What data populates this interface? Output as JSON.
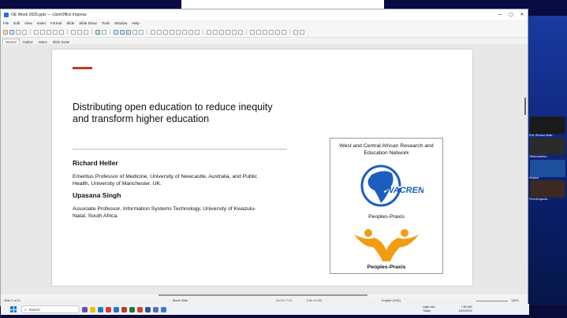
{
  "window": {
    "title": "OE Week 2025.pptx — LibreOffice Impress",
    "min": "—",
    "max": "▢",
    "close": "✕"
  },
  "menu": [
    "File",
    "Edit",
    "View",
    "Insert",
    "Format",
    "Slide",
    "Slide Show",
    "Tools",
    "Window",
    "Help"
  ],
  "tabs": [
    "Normal",
    "Outline",
    "Notes",
    "Slide Sorter"
  ],
  "slide": {
    "title": "Distributing open education to reduce inequity and transform higher education",
    "presenter1": {
      "name": "Richard Heller",
      "affiliation": "Emeritus Professor of Medicine, University of Newcastle, Australia, and Public Health, University of Manchester, UK."
    },
    "presenter2": {
      "name": "Upasana Singh",
      "affiliation": "Associate Professor, Information Systems Technology, University of Kwazulu-Natal, South Africa."
    },
    "logos": {
      "org_title": "West and Central African Research and Education Network",
      "wacren": "WACREN",
      "pp1": "Peoples-Praxis",
      "pp2": "Peoples-Praxis"
    }
  },
  "statusbar": {
    "slide": "Slide 1 of 11",
    "layout": "Blank Slide",
    "pos": "-10.74 / 7.21",
    "size": "0.00 x 0.00",
    "lang": "English (USA)",
    "zoom": "145%"
  },
  "taskbar": {
    "search_placeholder": "Search",
    "weather_temp": "Light rain",
    "weather_sub": "Today",
    "time": "7:50 AM",
    "date": "4/10/2025"
  },
  "participants": [
    "Prof. Richard Heller",
    "Clifah Ambrinu...",
    "Singhuu",
    "Femi Arogunda..."
  ],
  "colors": {
    "accent_red": "#c0392b",
    "wacren_blue": "#1a5fbf",
    "pp_orange": "#f39c12"
  }
}
